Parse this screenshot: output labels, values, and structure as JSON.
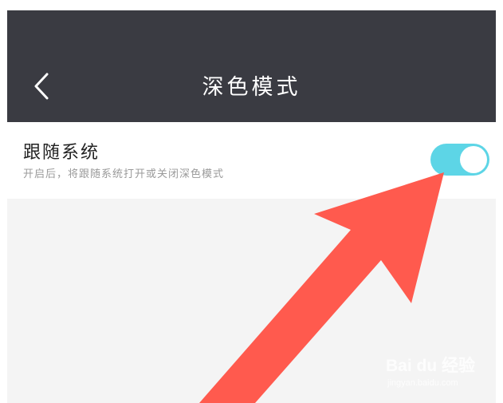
{
  "header": {
    "title": "深色模式",
    "back_icon": "chevron-left-icon"
  },
  "setting": {
    "title": "跟随系统",
    "description": "开启后，将跟随系统打开或关闭深色模式",
    "toggle_on": true
  },
  "watermark": {
    "logo_text": "Bai du 经验",
    "url": "jingyan.baidu.com"
  },
  "colors": {
    "header_bg": "#3a3b42",
    "toggle_on": "#5dd5e6",
    "arrow": "#ff5a4e",
    "page_bg": "#f4f4f4"
  }
}
